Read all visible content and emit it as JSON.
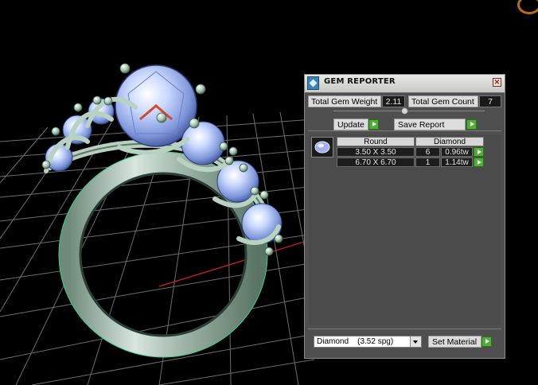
{
  "panel": {
    "title": "GEM REPORTER",
    "total_weight_label": "Total Gem Weight",
    "total_weight_value": "2.11",
    "total_count_label": "Total Gem Count",
    "total_count_value": "7",
    "update_label": "Update",
    "save_report_label": "Save Report",
    "table": {
      "headers": [
        "Round",
        "Diamond"
      ],
      "rows": [
        {
          "size": "3.50 X 3.50",
          "count": "6",
          "weight": "0.96tw"
        },
        {
          "size": "6.70 X 6.70",
          "count": "1",
          "weight": "1.14tw"
        }
      ]
    },
    "material_value": "Diamond    (3.52 spg)",
    "set_material_label": "Set Material"
  },
  "colors": {
    "panel_bg": "#4f4f4f",
    "go_button": "#4fae34",
    "grid": "#7a7a7a",
    "axis": "#c22"
  }
}
